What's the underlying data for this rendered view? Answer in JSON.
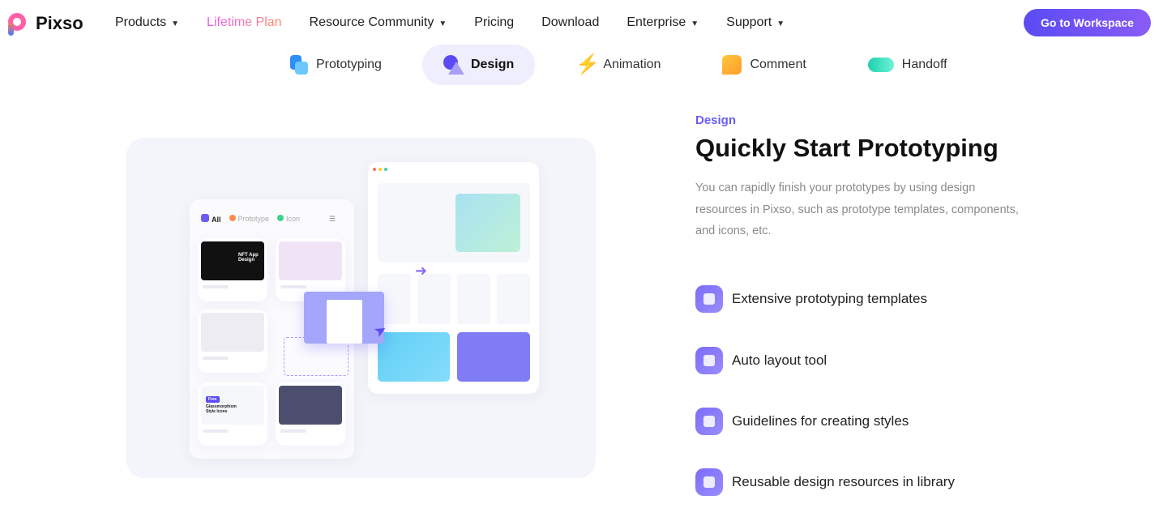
{
  "brand": {
    "name": "Pixso"
  },
  "nav": {
    "items": [
      {
        "label": "Products",
        "dropdown": true
      },
      {
        "label": "Lifetime Plan",
        "dropdown": false
      },
      {
        "label": "Resource Community",
        "dropdown": true
      },
      {
        "label": "Pricing",
        "dropdown": false
      },
      {
        "label": "Download",
        "dropdown": false
      },
      {
        "label": "Enterprise",
        "dropdown": true
      },
      {
        "label": "Support",
        "dropdown": true
      }
    ],
    "chevron": "⌄",
    "cta": "Go to Workspace"
  },
  "tabs": [
    {
      "label": "Prototyping",
      "icon": "prototyping-icon",
      "color": "#2f8ff7"
    },
    {
      "label": "Design",
      "icon": "design-icon",
      "color": "#6b5cf6",
      "active": true
    },
    {
      "label": "Animation",
      "icon": "lightning-icon",
      "color": "#ff4f8b"
    },
    {
      "label": "Comment",
      "icon": "comment-icon",
      "color": "#ffb020"
    },
    {
      "label": "Handoff",
      "icon": "toggle-icon",
      "color": "#20d1b0"
    }
  ],
  "illustration": {
    "filters": [
      "All",
      "Prototype",
      "Icon"
    ],
    "card1_title": "NFT App Design",
    "card5_title": "Glassmorphism Style Icons",
    "card5_badge": "Free"
  },
  "content": {
    "eyebrow": "Design",
    "title": "Quickly Start Prototyping",
    "description": "You can rapidly finish your prototypes by using design resources in Pixso, such as prototype templates, components, and icons, etc.",
    "features": [
      {
        "label": "Extensive prototyping templates",
        "icon": "layers-icon"
      },
      {
        "label": "Auto layout tool",
        "icon": "auto-layout-icon"
      },
      {
        "label": "Guidelines for creating styles",
        "icon": "styles-icon"
      },
      {
        "label": "Reusable design resources in library",
        "icon": "library-icon"
      }
    ]
  },
  "colors": {
    "accent": "#6b5cf6",
    "panel": "#f4f5fa"
  }
}
